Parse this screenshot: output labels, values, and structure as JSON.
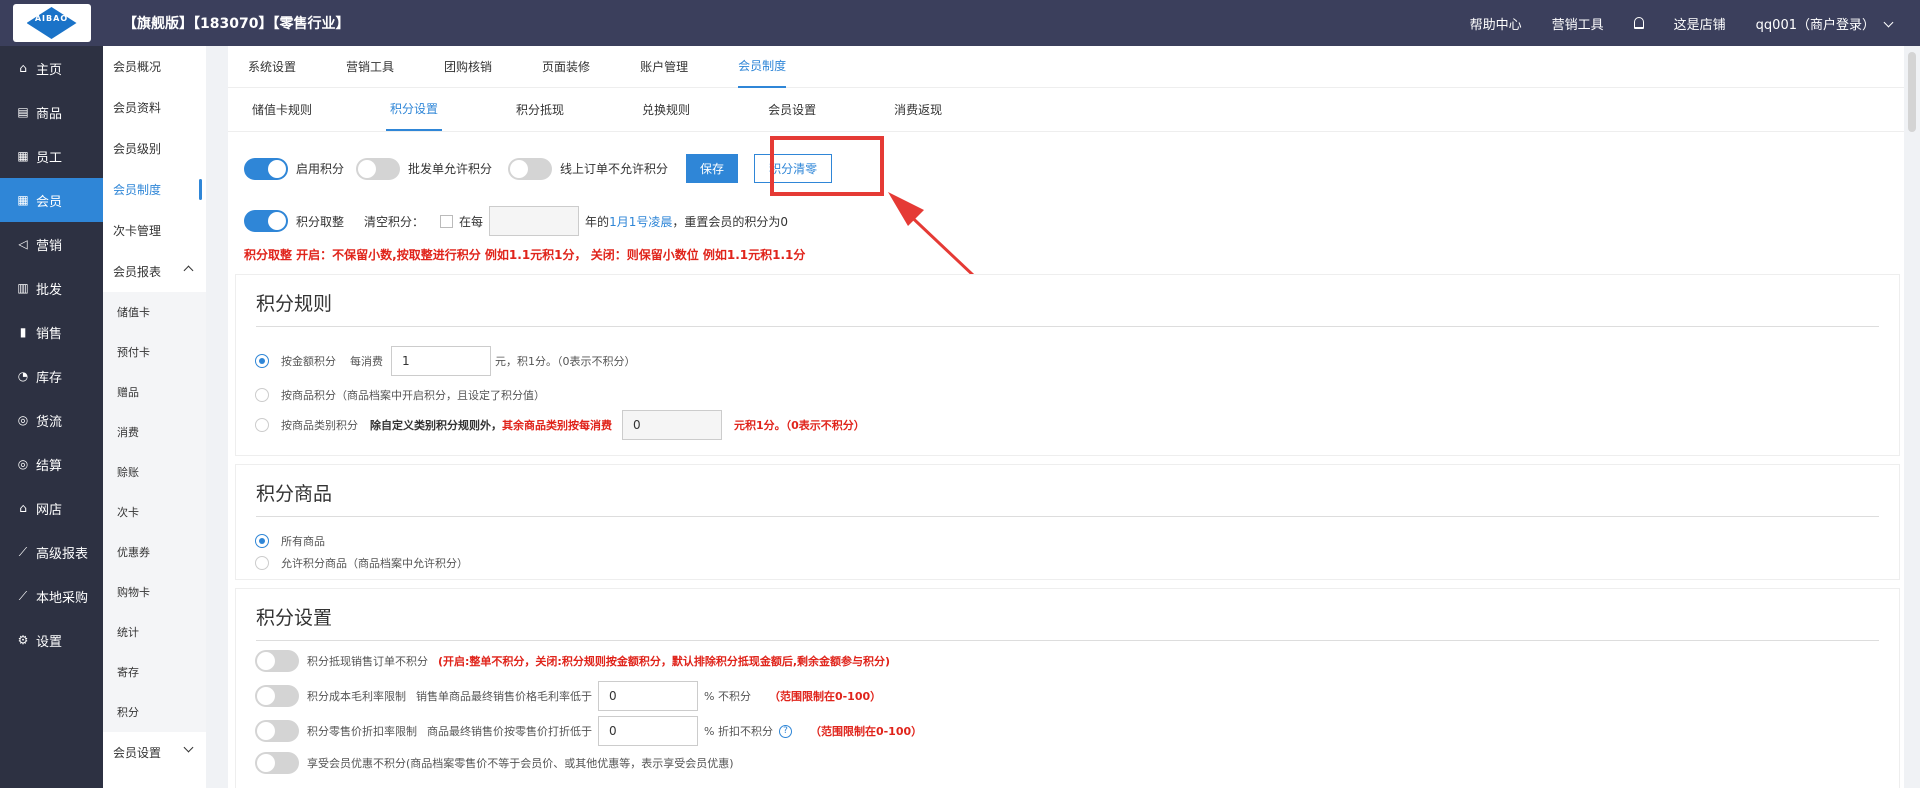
{
  "header": {
    "logo_text": "AIBAO",
    "store_title": "【旗舰版】【183070】【零售行业】",
    "help": "帮助中心",
    "marketing": "营销工具",
    "store": "这是店铺",
    "user": "qq001（商户登录）"
  },
  "sidebar": {
    "items": [
      {
        "icon": "⌂",
        "label": "主页"
      },
      {
        "icon": "▤",
        "label": "商品"
      },
      {
        "icon": "▦",
        "label": "员工"
      },
      {
        "icon": "▦",
        "label": "会员"
      },
      {
        "icon": "◁",
        "label": "营销"
      },
      {
        "icon": "▥",
        "label": "批发"
      },
      {
        "icon": "▮",
        "label": "销售"
      },
      {
        "icon": "◔",
        "label": "库存"
      },
      {
        "icon": "◎",
        "label": "货流"
      },
      {
        "icon": "◎",
        "label": "结算"
      },
      {
        "icon": "⌂",
        "label": "网店"
      },
      {
        "icon": "⟋",
        "label": "高级报表"
      },
      {
        "icon": "⟋",
        "label": "本地采购"
      },
      {
        "icon": "⚙",
        "label": "设置"
      }
    ]
  },
  "subnav": {
    "overview": "会员概况",
    "profile": "会员资料",
    "level": "会员级别",
    "system": "会员制度",
    "card": "次卡管理",
    "reports": "会员报表",
    "report_items": [
      "储值卡",
      "预付卡",
      "赠品",
      "消费",
      "赊账",
      "次卡",
      "优惠券",
      "购物卡",
      "统计",
      "寄存",
      "积分"
    ],
    "settings": "会员设置"
  },
  "tabs1": [
    "系统设置",
    "营销工具",
    "团购核销",
    "页面装修",
    "账户管理",
    "会员制度"
  ],
  "tabs2": [
    "储值卡规则",
    "积分设置",
    "积分抵现",
    "兑换规则",
    "会员设置",
    "消费返现"
  ],
  "top": {
    "enable_points": "启用积分",
    "wholesale_allow": "批发单允许积分",
    "online_disallow": "线上订单不允许积分",
    "save": "保存",
    "clear": "积分清零",
    "round": "积分取整",
    "clear_points": "清空积分：",
    "every": "在每",
    "year_of": "年的",
    "jan1": "1月1号凌晨",
    "reset": "，重置会员的积分为0",
    "note": "积分取整 开启：不保留小数,按取整进行积分 例如1.1元积1分，  关闭：则保留小数位 例如1.1元积1.1分"
  },
  "rules": {
    "title": "积分规则",
    "by_amount": "按金额积分",
    "each_spend": "每消费",
    "amount_value": "1",
    "yuan_one": "元，积1分。（0表示不积分）",
    "by_product": "按商品积分（商品档案中开启积分，且设定了积分值）",
    "by_category": "按商品类别积分",
    "except_custom": "除自定义类别积分规则外，",
    "rest_categories": "其余商品类别按每消费",
    "category_value": "0",
    "category_unit": "元积1分。（0表示不积分）"
  },
  "products": {
    "title": "积分商品",
    "all": "所有商品",
    "allowed": "允许积分商品（商品档案中允许积分）"
  },
  "settings": {
    "title": "积分设置",
    "s1_label": "积分抵现销售订单不积分",
    "s1_note": "(开启:整单不积分，关闭:积分规则按金额积分，默认排除积分抵现金额后,剩余金额参与积分)",
    "s2_label": "积分成本毛利率限制",
    "s2_desc": "销售单商品最终销售价格毛利率低于",
    "s2_value": "0",
    "s2_unit": "% 不积分",
    "s2_range": "（范围限制在0-100）",
    "s3_label": "积分零售价折扣率限制",
    "s3_desc": "商品最终销售价按零售价打折低于",
    "s3_value": "0",
    "s3_unit": "% 折扣不积分",
    "s3_range": "（范围限制在0-100）",
    "s4_label": "享受会员优惠不积分(商品档案零售价不等于会员价、或其他优惠等，表示享受会员优惠)"
  },
  "colors": {
    "header_bg": "#3b3f5c",
    "sidebar_bg": "#2d3142",
    "accent": "#2f86d7",
    "danger": "#e0241b"
  }
}
